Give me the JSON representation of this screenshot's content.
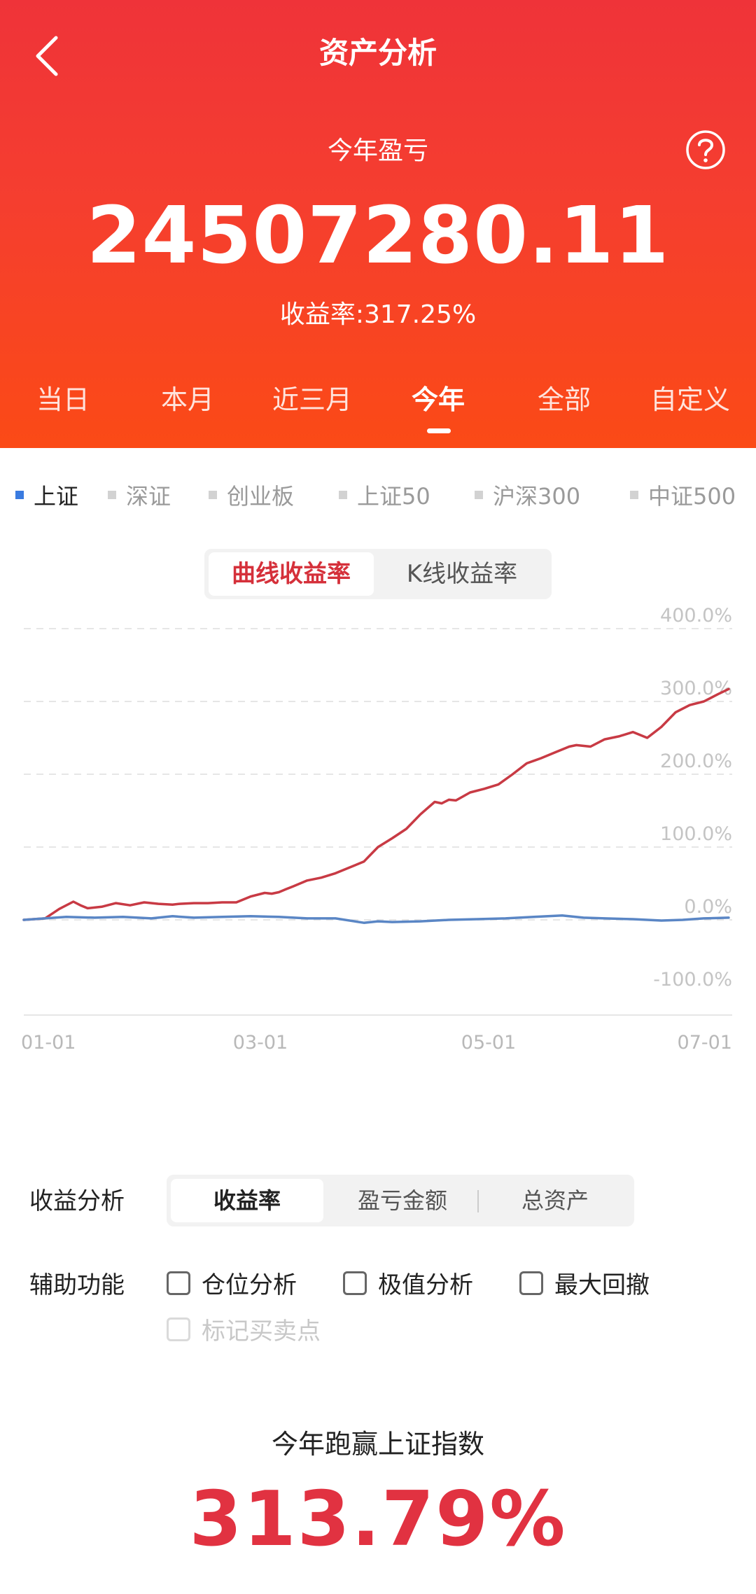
{
  "header": {
    "title": "资产分析",
    "label": "今年盈亏",
    "amount": "24507280.11",
    "rate": "收益率:317.25%"
  },
  "period_tabs": [
    "当日",
    "本月",
    "近三月",
    "今年",
    "全部",
    "自定义"
  ],
  "active_period": "今年",
  "indices": [
    "上证",
    "深证",
    "创业板",
    "上证50",
    "沪深300",
    "中证500"
  ],
  "active_index": "上证",
  "chart_mode": {
    "active": "曲线收益率",
    "inactive": "K线收益率"
  },
  "chart_data": {
    "type": "line",
    "x_ticks": [
      "01-01",
      "03-01",
      "05-01",
      "07-01"
    ],
    "y_ticks": [
      "400.0%",
      "300.0%",
      "200.0%",
      "100.0%",
      "0.0%",
      "-100.0%"
    ],
    "ylim": [
      -100,
      400
    ],
    "xlim": [
      0,
      100
    ],
    "grid": true,
    "series": [
      {
        "color": "#c83a44",
        "x": [
          0,
          3,
          5,
          7,
          8,
          9,
          11,
          13,
          15,
          17,
          19,
          21,
          22,
          24,
          26,
          28,
          30,
          32,
          34,
          35,
          36,
          37,
          38,
          40,
          42,
          44,
          46,
          48,
          49,
          50,
          52,
          54,
          56,
          58,
          59,
          60,
          61,
          63,
          65,
          67,
          69,
          71,
          73,
          75,
          77,
          78,
          80,
          82,
          84,
          86,
          88,
          90,
          91,
          92,
          94,
          96,
          98,
          99.5
        ],
        "values": [
          0,
          2,
          15,
          25,
          20,
          16,
          18,
          23,
          20,
          24,
          22,
          21,
          22,
          23,
          23,
          24,
          24,
          32,
          37,
          36,
          38,
          42,
          46,
          54,
          58,
          64,
          72,
          80,
          90,
          100,
          112,
          125,
          145,
          162,
          160,
          165,
          164,
          175,
          180,
          186,
          200,
          215,
          222,
          230,
          238,
          240,
          238,
          248,
          252,
          258,
          250,
          265,
          275,
          285,
          295,
          300,
          310,
          317
        ]
      },
      {
        "color": "#5a86c5",
        "x": [
          0,
          3,
          6,
          10,
          14,
          18,
          21,
          24,
          28,
          32,
          36,
          40,
          44,
          48,
          50,
          52,
          56,
          60,
          64,
          68,
          72,
          76,
          79,
          82,
          86,
          90,
          93,
          96,
          99.5
        ],
        "values": [
          0,
          2,
          4,
          3,
          4,
          2,
          5,
          3,
          4,
          5,
          4,
          2,
          2,
          -4,
          -2,
          -3,
          -2,
          0,
          1,
          2,
          4,
          6,
          3,
          2,
          1,
          -1,
          0,
          2,
          3
        ]
      }
    ]
  },
  "analysis": {
    "label": "收益分析",
    "options": [
      "收益率",
      "盈亏金额",
      "总资产"
    ],
    "active": "收益率"
  },
  "aux": {
    "label": "辅助功能",
    "options": [
      "仓位分析",
      "极值分析",
      "最大回撤"
    ],
    "disabled_option": "标记买卖点"
  },
  "beat": {
    "label": "今年跑赢上证指数",
    "value": "313.79%"
  },
  "colors": {
    "header_top": "#ef3339",
    "header_bottom": "#fb4a16",
    "accent_red": "#e13241",
    "index_blue": "#3a7be0"
  }
}
